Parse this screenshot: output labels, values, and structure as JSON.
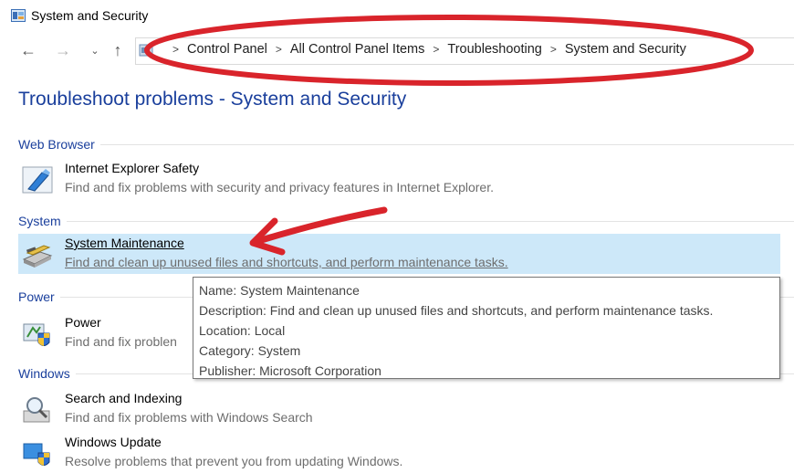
{
  "window": {
    "title": "System and Security"
  },
  "nav": {
    "back": "←",
    "forward": "→",
    "recent": "⌄",
    "up": "↑"
  },
  "address_bar": {
    "separator": ">",
    "crumbs": [
      "Control Panel",
      "All Control Panel Items",
      "Troubleshooting",
      "System and Security"
    ]
  },
  "page": {
    "title": "Troubleshoot problems - System and Security"
  },
  "groups": [
    {
      "header": "Web Browser",
      "items": [
        {
          "name": "Internet Explorer Safety",
          "description": "Find and fix problems with security and privacy features in Internet Explorer.",
          "icon": "internet-explorer-shield-icon"
        }
      ]
    },
    {
      "header": "System",
      "items": [
        {
          "name": "System Maintenance",
          "description": "Find and clean up unused files and shortcuts, and perform maintenance tasks.",
          "icon": "system-maintenance-icon",
          "selected": true
        }
      ]
    },
    {
      "header": "Power",
      "items": [
        {
          "name": "Power",
          "description": "Find and fix problen",
          "icon": "power-shield-icon"
        }
      ]
    },
    {
      "header": "Windows",
      "items": [
        {
          "name": "Search and Indexing",
          "description": "Find and fix problems with Windows Search",
          "icon": "search-indexing-icon"
        },
        {
          "name": "Windows Update",
          "description": "Resolve problems that prevent you from updating Windows.",
          "icon": "windows-update-icon"
        }
      ]
    }
  ],
  "tooltip": {
    "lines": [
      "Name: System Maintenance",
      "Description: Find and clean up unused files and shortcuts, and perform maintenance tasks.",
      "Location: Local",
      "Category: System",
      "Publisher: Microsoft Corporation"
    ]
  },
  "annotations": {
    "color": "#d9242b"
  }
}
